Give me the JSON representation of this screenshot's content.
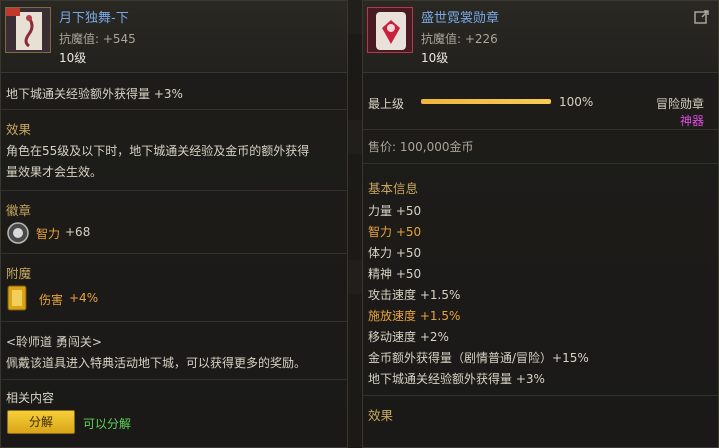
{
  "left_item": {
    "name": "月下独舞-下",
    "stat": "抗魔值: +545",
    "level": "10级",
    "bonus": "地下城通关经验额外获得量 +3%",
    "effect_title": "效果",
    "effect_line1": "角色在55级及以下时，地下城通关经验及金币的额外获得",
    "effect_line2": "量效果才会生效。",
    "emblem_title": "徽章",
    "emblem_stat": "智力",
    "emblem_value": "+68",
    "enchant_title": "附魔",
    "enchant_stat": "伤害",
    "enchant_value": "+4%",
    "quest_line1": "<聆师道 勇闯关>",
    "quest_line2": "佩戴该道具进入特典活动地下城，可以获得更多的奖励。",
    "related_title": "相关内容",
    "split_button": "分解",
    "split_status": "可以分解"
  },
  "right_item": {
    "name": "盛世霓裳勋章",
    "stat": "抗魔值: +226",
    "level": "10级",
    "upgrade_label": "最上级",
    "upgrade_percent": "100%",
    "upgrade_fraction": 1.0,
    "type_label": "冒险勋章",
    "rarity_label": "神器",
    "price": "售价: 100,000金币",
    "basic_title": "基本信息",
    "stats": [
      {
        "label": "力量 +50",
        "highlight": false
      },
      {
        "label": "智力 +50",
        "highlight": true
      },
      {
        "label": "体力 +50",
        "highlight": false
      },
      {
        "label": "精神 +50",
        "highlight": false
      },
      {
        "label": "攻击速度 +1.5%",
        "highlight": false
      },
      {
        "label": "施放速度 +1.5%",
        "highlight": true
      },
      {
        "label": "移动速度 +2%",
        "highlight": false
      },
      {
        "label": "金币额外获得量（剧情普通/冒险）+15%",
        "highlight": false
      },
      {
        "label": "地下城通关经验额外获得量 +3%",
        "highlight": false
      }
    ],
    "effect_title": "效果"
  },
  "colors": {
    "name_blue": "#79a7e3",
    "section_gold": "#c7a75f",
    "highlight_orange": "#e8a33c",
    "split_green": "#5ed35a",
    "rarity_magenta": "#e04ae0",
    "button_yellow": "#f6cf3a"
  }
}
